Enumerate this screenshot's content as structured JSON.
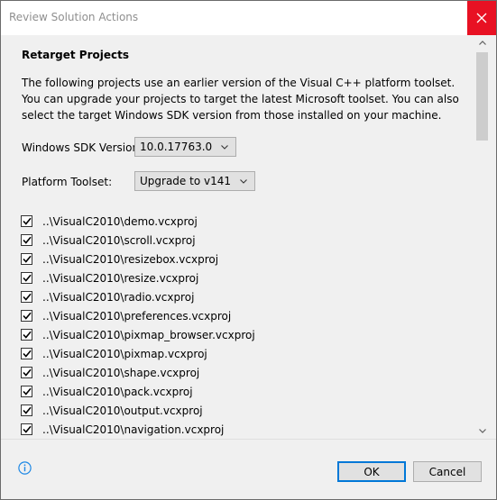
{
  "window": {
    "title": "Review Solution Actions"
  },
  "section": {
    "title": "Retarget Projects",
    "description": "The following projects use an earlier version of the Visual C++ platform toolset.  You can upgrade your projects to target the latest Microsoft toolset.  You can also select the target Windows SDK version from those installed on your machine."
  },
  "sdk": {
    "label": "Windows SDK Version:",
    "value": "10.0.17763.0"
  },
  "toolset": {
    "label": "Platform Toolset:",
    "value": "Upgrade to v141"
  },
  "projects": [
    {
      "path": "..\\VisualC2010\\demo.vcxproj",
      "checked": true
    },
    {
      "path": "..\\VisualC2010\\scroll.vcxproj",
      "checked": true
    },
    {
      "path": "..\\VisualC2010\\resizebox.vcxproj",
      "checked": true
    },
    {
      "path": "..\\VisualC2010\\resize.vcxproj",
      "checked": true
    },
    {
      "path": "..\\VisualC2010\\radio.vcxproj",
      "checked": true
    },
    {
      "path": "..\\VisualC2010\\preferences.vcxproj",
      "checked": true
    },
    {
      "path": "..\\VisualC2010\\pixmap_browser.vcxproj",
      "checked": true
    },
    {
      "path": "..\\VisualC2010\\pixmap.vcxproj",
      "checked": true
    },
    {
      "path": "..\\VisualC2010\\shape.vcxproj",
      "checked": true
    },
    {
      "path": "..\\VisualC2010\\pack.vcxproj",
      "checked": true
    },
    {
      "path": "..\\VisualC2010\\output.vcxproj",
      "checked": true
    },
    {
      "path": "..\\VisualC2010\\navigation.vcxproj",
      "checked": true
    }
  ],
  "buttons": {
    "ok": "OK",
    "cancel": "Cancel"
  },
  "colors": {
    "close_red": "#e81123",
    "focus_blue": "#0078d7",
    "info_blue": "#1e88e5"
  },
  "icons": {
    "close": "close-icon",
    "chevron": "chevron-down-icon",
    "info": "info-icon",
    "check": "checkmark-icon"
  }
}
